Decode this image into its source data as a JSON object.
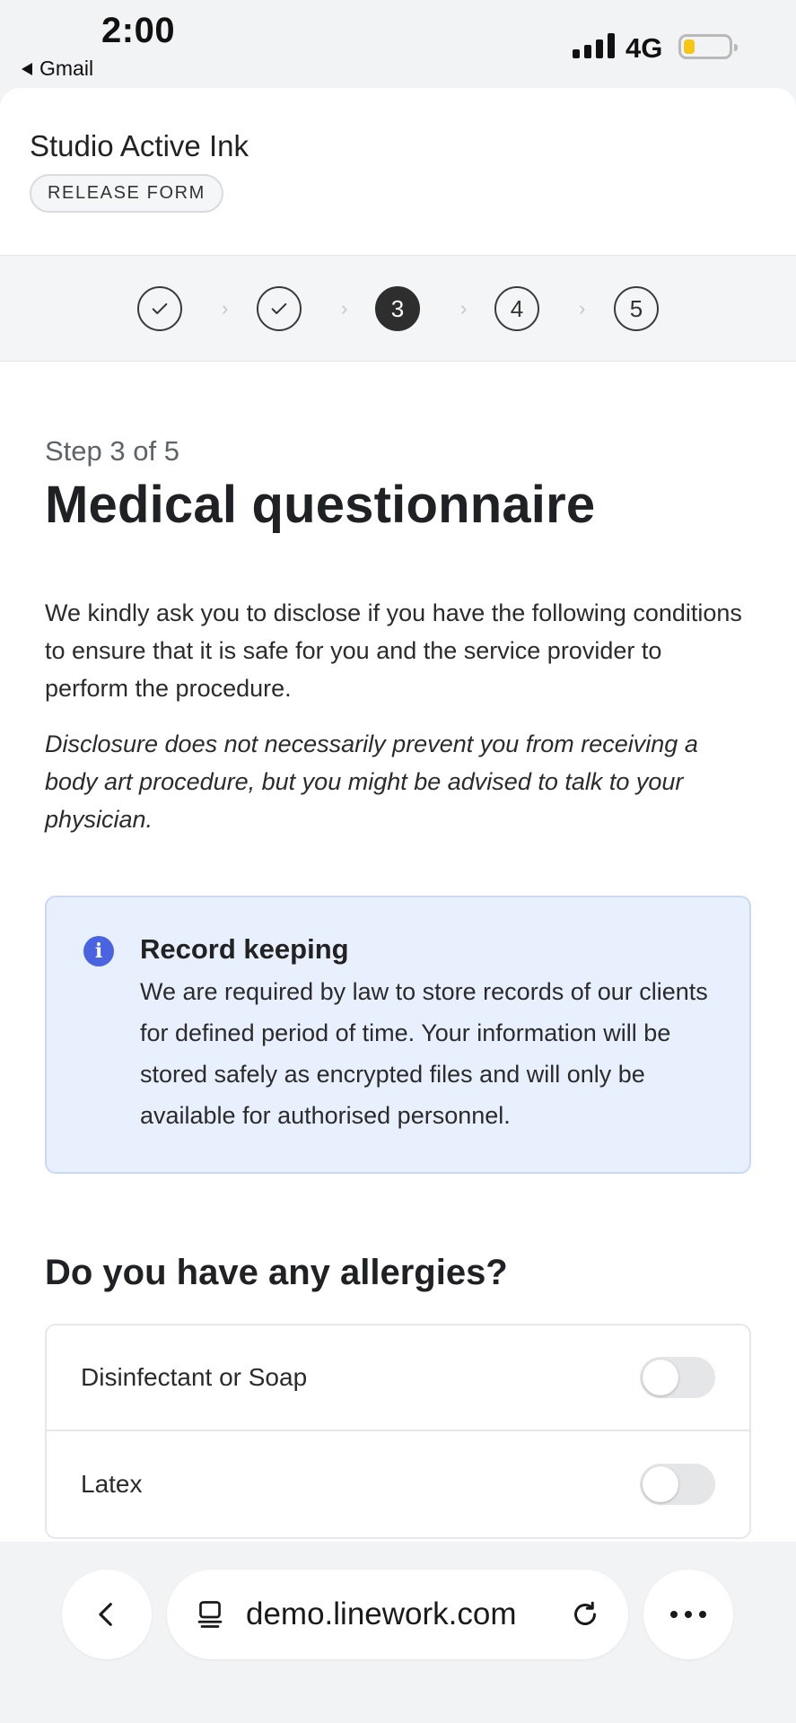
{
  "status_bar": {
    "time": "2:00",
    "back_app": "Gmail",
    "network": "4G"
  },
  "header": {
    "studio_name": "Studio Active Ink",
    "form_badge": "RELEASE FORM"
  },
  "stepper": {
    "current_step": 3,
    "total_steps": 5,
    "steps": [
      {
        "label": "",
        "state": "complete"
      },
      {
        "label": "",
        "state": "complete"
      },
      {
        "label": "3",
        "state": "active"
      },
      {
        "label": "4",
        "state": "upcoming"
      },
      {
        "label": "5",
        "state": "upcoming"
      }
    ]
  },
  "main": {
    "step_label": "Step 3 of 5",
    "title": "Medical questionnaire",
    "intro": "We kindly ask you to disclose if you have the following conditions to ensure that it is safe for you and the service provider to perform the procedure.",
    "note": "Disclosure does not necessarily prevent you from receiving a body art procedure, but you might be advised to talk to your physician.",
    "info_box": {
      "icon": "info-icon",
      "title": "Record keeping",
      "text": "We are required by law to store records of our clients for defined period of time. Your information will be stored safely as encrypted files and will only be available for authorised personnel."
    },
    "question": "Do you have any allergies?",
    "options": [
      {
        "label": "Disinfectant or Soap",
        "enabled": false
      },
      {
        "label": "Latex",
        "enabled": false
      }
    ]
  },
  "browser": {
    "url": "demo.linework.com",
    "icons": [
      "back-icon",
      "tab-icon",
      "reload-icon",
      "more-icon"
    ]
  },
  "colors": {
    "info_bg": "#e8f0fd",
    "info_border": "#c8d8f5",
    "info_icon": "#4a63e0",
    "active_step": "#2e2e2e",
    "battery_level": "#f5c518"
  }
}
